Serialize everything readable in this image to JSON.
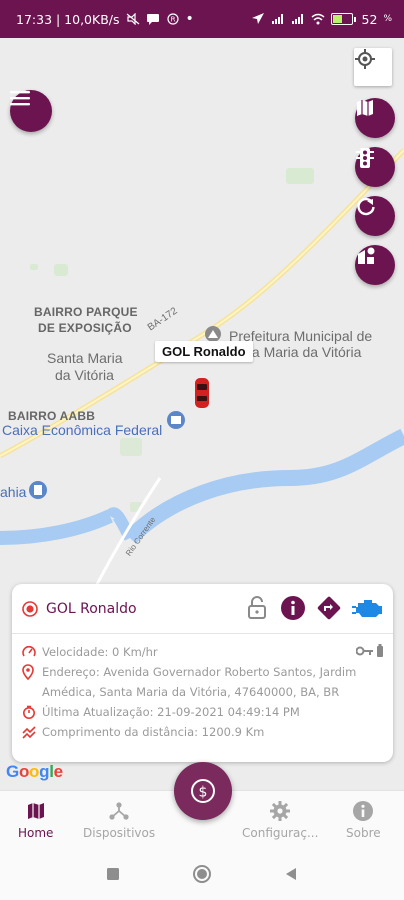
{
  "status_bar": {
    "time_info": "17:33 | 10,0KB/s",
    "battery": "52",
    "battery_fill": 0.52
  },
  "map": {
    "labels": {
      "bairro_parque_1": "BAIRRO PARQUE",
      "bairro_parque_2": "DE EXPOSIÇÃO",
      "road_ba172": "BA-172",
      "prefeitura_1": "Prefeitura Municipal de",
      "prefeitura_2": "ta Maria da Vitória",
      "santa_maria_1": "Santa Maria",
      "santa_maria_2": "da Vitória",
      "bairro_aabb": "BAIRRO AABB",
      "caixa": "Caixa Econômica Federal",
      "ahia": "ahia",
      "road_corrente": "Rio Corrente"
    },
    "car_tooltip": "GOL Ronaldo",
    "google": [
      "G",
      "o",
      "o",
      "g",
      "l",
      "e"
    ],
    "google_colors": [
      "#4285f4",
      "#ea4335",
      "#fbbc05",
      "#4285f4",
      "#34a853",
      "#ea4335"
    ]
  },
  "card": {
    "title": "GOL Ronaldo",
    "speed": "Velocidade: 0 Km/hr",
    "address": "Endereço: Avenida Governador Roberto Santos, Jardim Amédica, Santa Maria da Vitória, 47640000, BA, BR",
    "last_update": "Última Atualização: 21-09-2021 04:49:14 PM",
    "distance": "Comprimento da distância: 1200.9 Km"
  },
  "bottom_nav": {
    "home": "Home",
    "devices": "Dispositivos",
    "settings": "Configuraç...",
    "about": "Sobre"
  },
  "colors": {
    "primary": "#6b1450",
    "accent_red": "#e53935",
    "engine_blue": "#1e88e5"
  }
}
